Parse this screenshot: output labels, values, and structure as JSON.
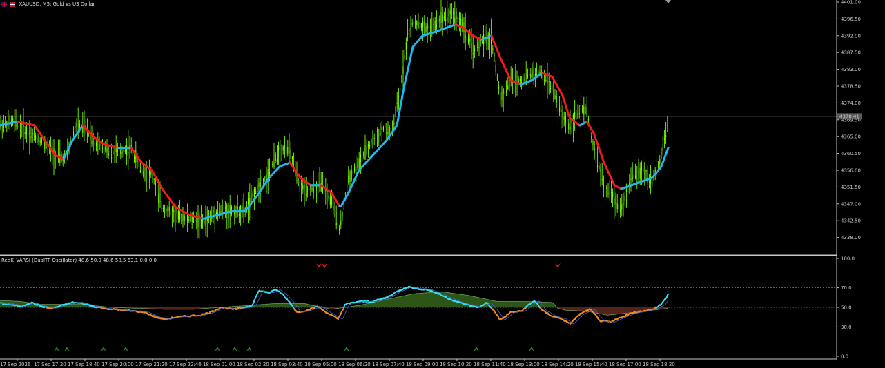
{
  "window": {
    "symbol_title": "XAUUSD, M5:  Gold vs US Dollar"
  },
  "indicator": {
    "title": "RedK_VARSI (DualTF Oscillator) 48.6 50.0 48.6 58.5 63.1 0.0 0.0",
    "levels": [
      "100.0",
      "70.0",
      "50.0",
      "30.0",
      "0.0"
    ]
  },
  "price_axis": {
    "labels": [
      "4401.00",
      "4396.50",
      "4392.00",
      "4387.50",
      "4383.00",
      "4378.50",
      "4374.00",
      "4369.50",
      "4365.00",
      "4360.50",
      "4356.00",
      "4351.50",
      "4347.00",
      "4342.50",
      "4338.00"
    ],
    "current_price": "4370.41"
  },
  "time_axis": {
    "labels": [
      "17 Sep 2026",
      "17 Sep 17:20",
      "17 Sep 18:40",
      "17 Sep 20:00",
      "17 Sep 21:20",
      "17 Sep 22:40",
      "18 Sep 01:00",
      "18 Sep 02:20",
      "18 Sep 03:40",
      "18 Sep 05:00",
      "18 Sep 06:20",
      "18 Sep 07:40",
      "18 Sep 09:00",
      "18 Sep 10:20",
      "18 Sep 11:40",
      "18 Sep 13:00",
      "18 Sep 14:20",
      "18 Sep 15:40",
      "18 Sep 17:00",
      "18 Sep 18:20"
    ]
  },
  "colors": {
    "candle": "#7CFC00",
    "ma_up": "#1EB8F0",
    "ma_down": "#F01C1C",
    "osc_up": "#3ADCF0",
    "osc_down": "#F08A24",
    "fill_up": "#2F5A18",
    "fill_down": "#5A241C",
    "level_line": "#B36A1E",
    "price_line": "#808080"
  },
  "icons": {
    "flag": "uk-us-flag-icon",
    "indicator_buy_marker": "green-arrow-icon",
    "indicator_sell_marker": "red-arrow-icon"
  }
}
